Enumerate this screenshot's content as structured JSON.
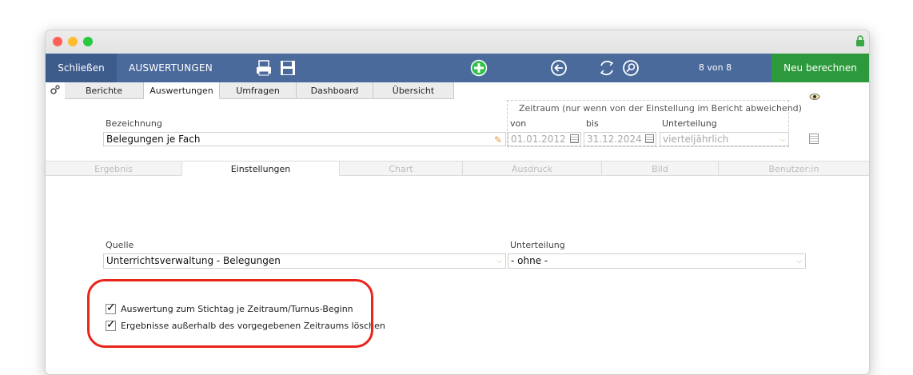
{
  "toolbar": {
    "close_label": "Schließen",
    "title": "AUSWERTUNGEN",
    "counter": "8 von 8",
    "recalc_label": "Neu berechnen"
  },
  "main_tabs": [
    {
      "label": "Berichte"
    },
    {
      "label": "Auswertungen"
    },
    {
      "label": "Umfragen"
    },
    {
      "label": "Dashboard"
    },
    {
      "label": "Übersicht"
    }
  ],
  "header": {
    "bezeichnung_label": "Bezeichnung",
    "bezeichnung_value": "Belegungen je Fach",
    "zeitraum_caption": "Zeitraum (nur wenn von der Einstellung im Bericht abweichend)",
    "von_label": "von",
    "von_value": "01.01.2012",
    "bis_label": "bis",
    "bis_value": "31.12.2024",
    "unterteilung_label": "Unterteilung",
    "unterteilung_value": "vierteljährlich"
  },
  "sub_tabs": [
    {
      "label": "Ergebnis"
    },
    {
      "label": "Einstellungen"
    },
    {
      "label": "Chart"
    },
    {
      "label": "Ausdruck"
    },
    {
      "label": "Bild"
    },
    {
      "label": "Benutzer:in"
    }
  ],
  "settings": {
    "quelle_label": "Quelle",
    "quelle_value": "Unterrichtsverwaltung - Belegungen",
    "unterteilung_label": "Unterteilung",
    "unterteilung_value": "- ohne -",
    "checkboxes": [
      {
        "label": "Auswertung zum Stichtag je Zeitraum/Turnus-Beginn",
        "checked": true
      },
      {
        "label": "Ergebnisse außerhalb des vorgegebenen Zeitraums löschen",
        "checked": true
      }
    ]
  },
  "colors": {
    "toolbar": "#4a6a9c",
    "recalc": "#2c9a3c",
    "highlight": "#e8241b"
  }
}
